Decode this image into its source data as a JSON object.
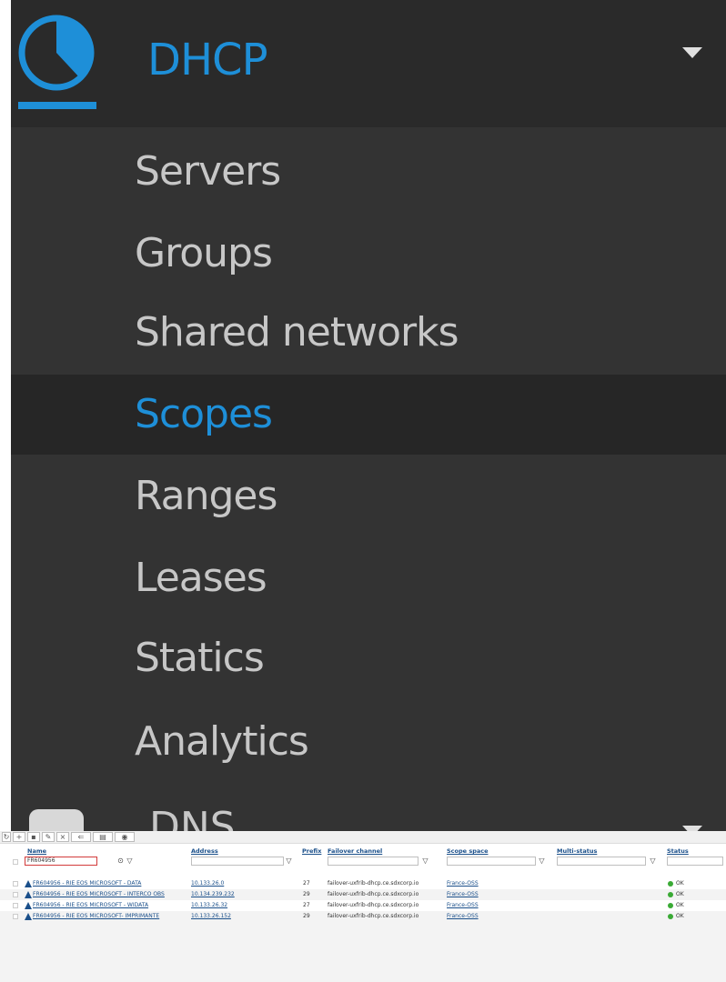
{
  "menu": {
    "title": "DHCP",
    "title_icon": "pie-chart-icon",
    "items": [
      {
        "label": "Servers",
        "active": false
      },
      {
        "label": "Groups",
        "active": false
      },
      {
        "label": "Shared networks",
        "active": false
      },
      {
        "label": "Scopes",
        "active": true
      },
      {
        "label": "Ranges",
        "active": false
      },
      {
        "label": "Leases",
        "active": false
      },
      {
        "label": "Statics",
        "active": false
      },
      {
        "label": "Analytics",
        "active": false
      }
    ],
    "next_section": "DNS",
    "colors": {
      "accent": "#1e8fd8",
      "bg": "#333333",
      "header_bg": "#2a2a2a",
      "active_bg": "#262626",
      "text": "#c7c7c7"
    }
  },
  "grid": {
    "columns": {
      "name": "Name",
      "address": "Address",
      "prefix": "Prefix",
      "failover": "Failover channel",
      "scope_space": "Scope space",
      "multi_status": "Multi-status",
      "status": "Status"
    },
    "name_filter_value": "FR604956",
    "rows": [
      {
        "name": "FR604956 - RIE EOS MICROSOFT - DATA",
        "address": "10.133.26.0",
        "prefix": "27",
        "failover": "failover-uxfrib-dhcp.ce.sdxcorp.io",
        "scope_space": "France-OSS",
        "status": "OK"
      },
      {
        "name": "FR604956 - RIE EOS MICROSOFT - INTERCO OBS",
        "address": "10.134.239.232",
        "prefix": "29",
        "failover": "failover-uxfrib-dhcp.ce.sdxcorp.io",
        "scope_space": "France-OSS",
        "status": "OK"
      },
      {
        "name": "FR604956 - RIE EOS MICROSOFT - WIDATA",
        "address": "10.133.26.32",
        "prefix": "27",
        "failover": "failover-uxfrib-dhcp.ce.sdxcorp.io",
        "scope_space": "France-OSS",
        "status": "OK"
      },
      {
        "name": "FR604956 - RIE EOS MICROSOFT- IMPRIMANTE",
        "address": "10.133.26.152",
        "prefix": "29",
        "failover": "failover-uxfrib-dhcp.ce.sdxcorp.io",
        "scope_space": "France-OSS",
        "status": "OK"
      }
    ],
    "status_color": "#3aaa35",
    "link_color": "#1a4f8a"
  }
}
